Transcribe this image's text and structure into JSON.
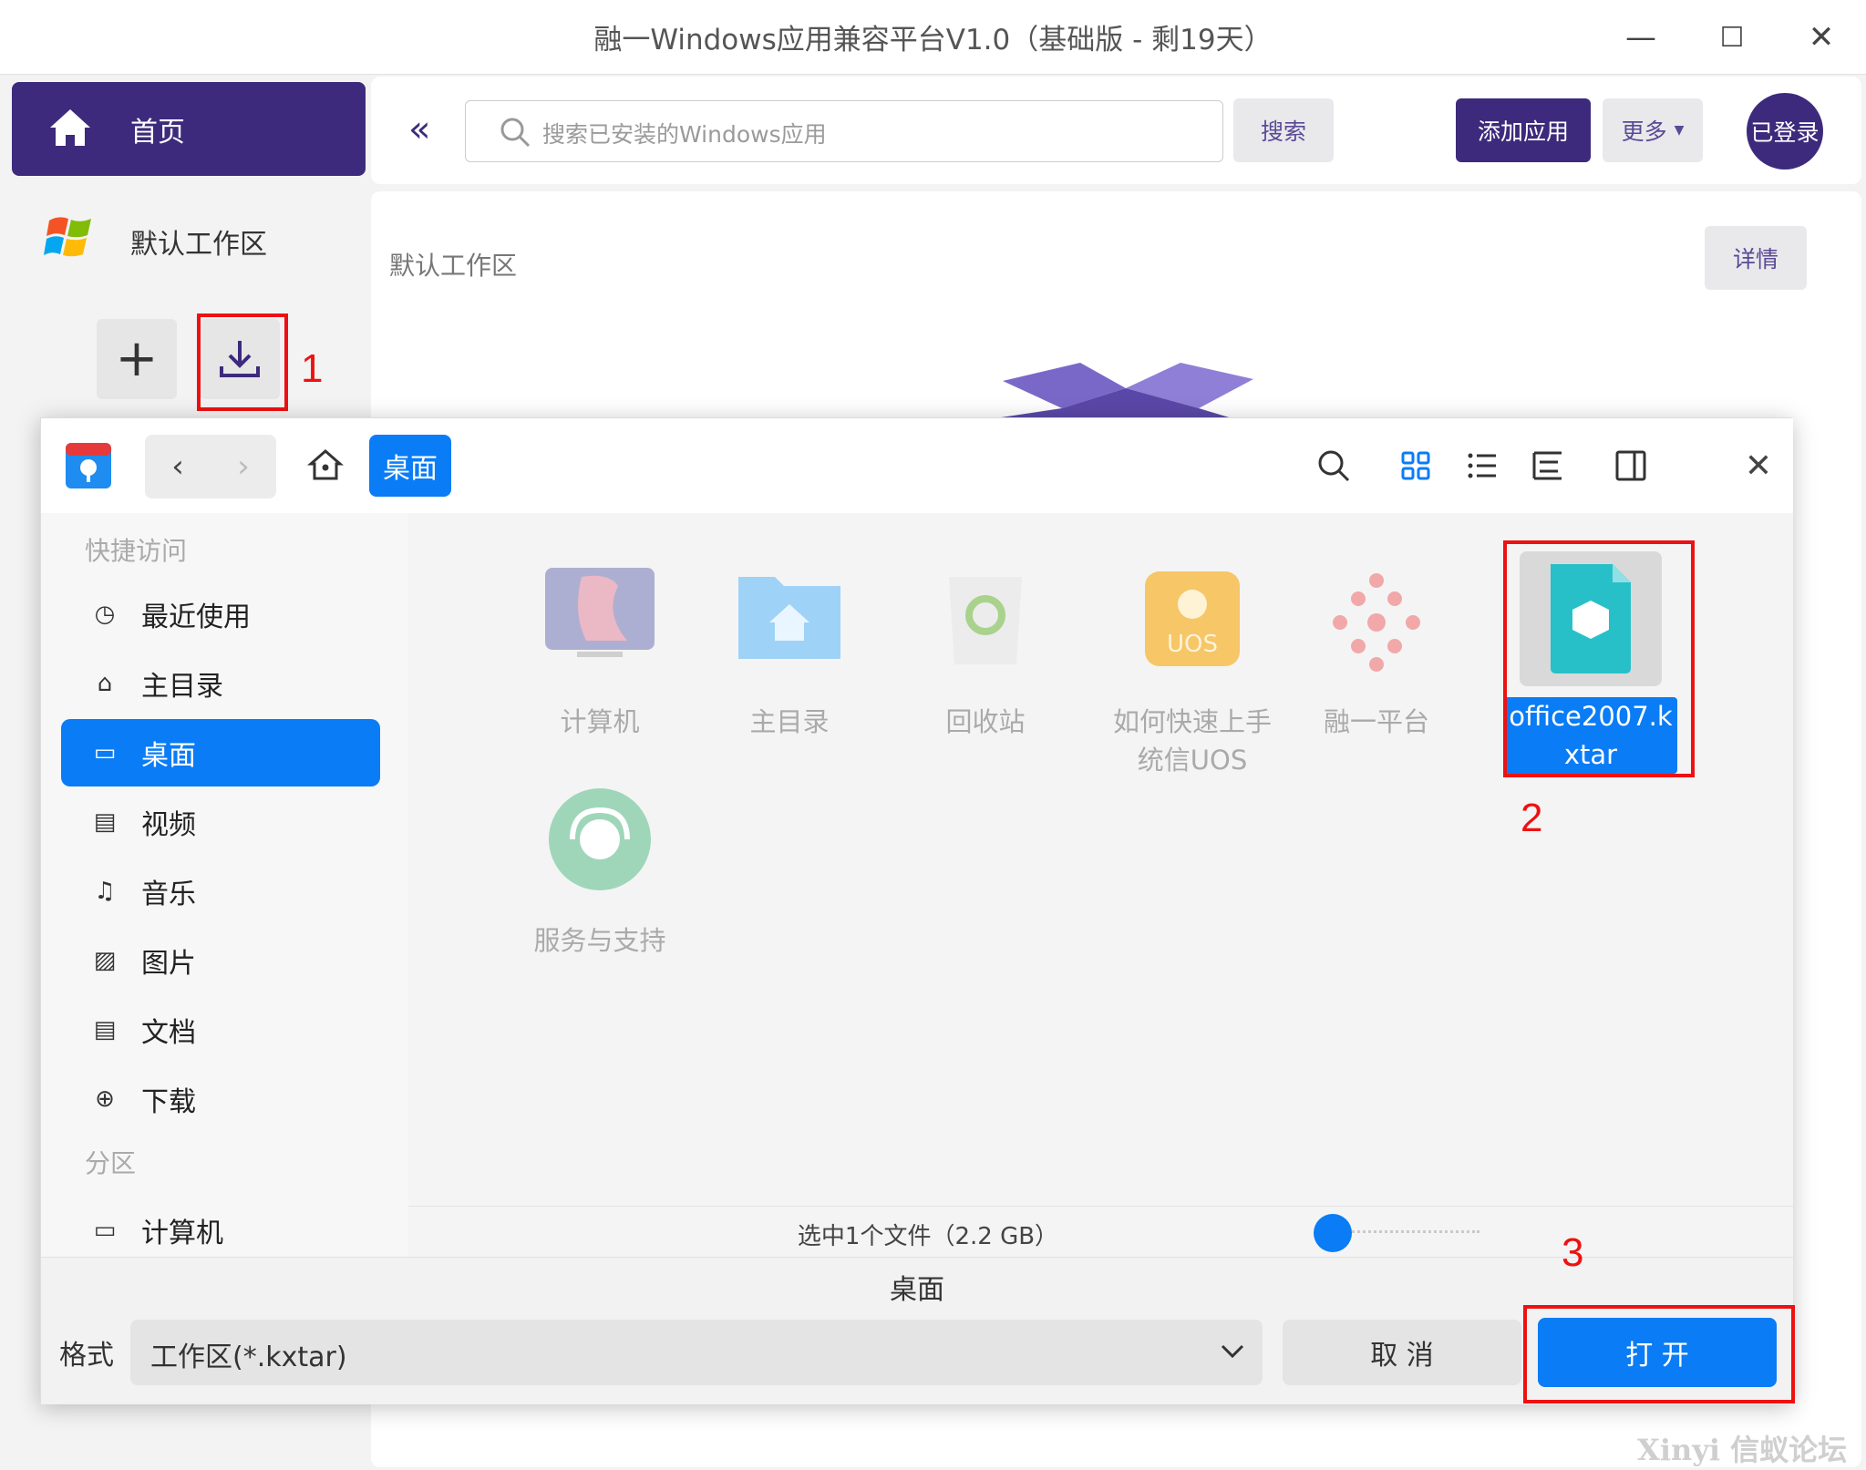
{
  "window": {
    "title": "融一Windows应用兼容平台V1.0（基础版 - 剩19天）",
    "minimize": "—",
    "maximize": "☐",
    "close": "✕"
  },
  "sidebar": {
    "home_label": "首页",
    "workspace_label": "默认工作区",
    "add_label": "+",
    "annotation_1": "1"
  },
  "topbar": {
    "collapse_label": "«",
    "search_placeholder": "搜索已安装的Windows应用",
    "search_button": "搜索",
    "add_app_button": "添加应用",
    "more_button": "更多",
    "login_button": "已登录"
  },
  "main": {
    "workspace_title": "默认工作区",
    "details_button": "详情"
  },
  "dialog": {
    "breadcrumb": "桌面",
    "sidebar": {
      "quick_access_heading": "快捷访问",
      "items": [
        {
          "label": "最近使用",
          "icon": "clock-icon"
        },
        {
          "label": "主目录",
          "icon": "home-icon"
        },
        {
          "label": "桌面",
          "icon": "desktop-icon",
          "selected": true
        },
        {
          "label": "视频",
          "icon": "film-icon"
        },
        {
          "label": "音乐",
          "icon": "music-icon"
        },
        {
          "label": "图片",
          "icon": "image-icon"
        },
        {
          "label": "文档",
          "icon": "document-icon"
        },
        {
          "label": "下载",
          "icon": "download-icon"
        }
      ],
      "partition_heading": "分区",
      "partition_items": [
        {
          "label": "计算机",
          "icon": "monitor-icon"
        }
      ]
    },
    "files": [
      {
        "label": "计算机",
        "icon": "computer-icon"
      },
      {
        "label": "主目录",
        "icon": "home-folder-icon"
      },
      {
        "label": "回收站",
        "icon": "trash-icon"
      },
      {
        "label": "如何快速上手统信UOS",
        "icon": "uos-guide-icon"
      },
      {
        "label": "融一平台",
        "icon": "rongyi-icon"
      },
      {
        "label": "office2007.kxtar",
        "icon": "kxtar-file-icon",
        "selected": true
      },
      {
        "label": "服务与支持",
        "icon": "support-icon"
      }
    ],
    "annotation_2": "2",
    "status": "选中1个文件（2.2 GB）",
    "zoom_level": 0.05,
    "bottom": {
      "location": "桌面",
      "format_label": "格式",
      "format_value": "工作区(*.kxtar)",
      "cancel_button": "取 消",
      "open_button": "打 开",
      "annotation_3": "3"
    }
  },
  "watermark": "Xinyi 信蚁论坛",
  "colors": {
    "brand_purple": "#3d2a7c",
    "accent_blue": "#0a7cf5",
    "annotation_red": "#e11111"
  }
}
